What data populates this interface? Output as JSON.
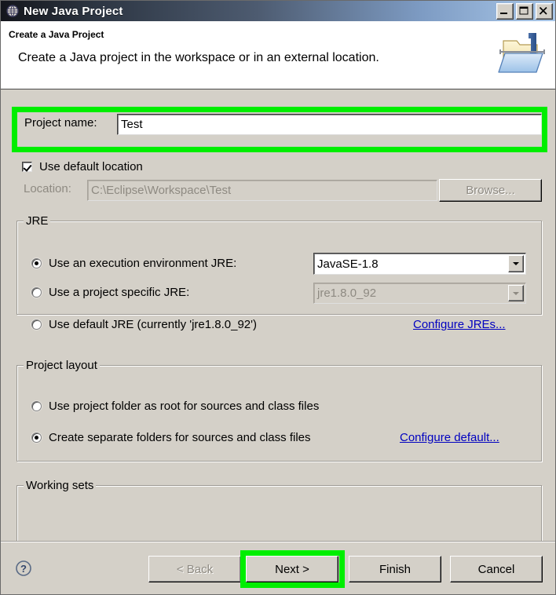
{
  "window": {
    "title": "New Java Project",
    "title_icon": "java-project-icon",
    "controls": {
      "minimize": "minimize-button",
      "maximize": "maximize-button",
      "close": "close-button"
    }
  },
  "header": {
    "title": "Create a Java Project",
    "description": "Create a Java project in the workspace or in an external location.",
    "icon": "new-java-project-folder-icon"
  },
  "project": {
    "name_label": "Project name:",
    "name_value": "Test",
    "name_placeholder": ""
  },
  "location": {
    "use_default_label": "Use default location",
    "use_default_checked": true,
    "location_label": "Location:",
    "location_value": "C:\\Eclipse\\Workspace\\Test",
    "browse_label": "Browse...",
    "browse_enabled": false
  },
  "jre": {
    "group_label": "JRE",
    "option_execution_env": "Use an execution environment JRE:",
    "execution_env_value": "JavaSE-1.8",
    "option_project_specific": "Use a project specific JRE:",
    "project_specific_value": "jre1.8.0_92",
    "option_default": "Use default JRE (currently 'jre1.8.0_92')",
    "configure_link": "Configure JREs...",
    "selected": "execution_env"
  },
  "project_layout": {
    "group_label": "Project layout",
    "option_project_folder": "Use project folder as root for sources and class files",
    "option_separate_folders": "Create separate folders for sources and class files",
    "configure_link": "Configure default...",
    "selected": "separate_folders"
  },
  "working_sets": {
    "group_label": "Working sets"
  },
  "buttons": {
    "help": "?",
    "back": "< Back",
    "back_enabled": false,
    "next": "Next >",
    "finish": "Finish",
    "cancel": "Cancel"
  },
  "annotations": {
    "highlight_color": "#00ee00",
    "targets": [
      "project-name-row",
      "next-button"
    ]
  }
}
